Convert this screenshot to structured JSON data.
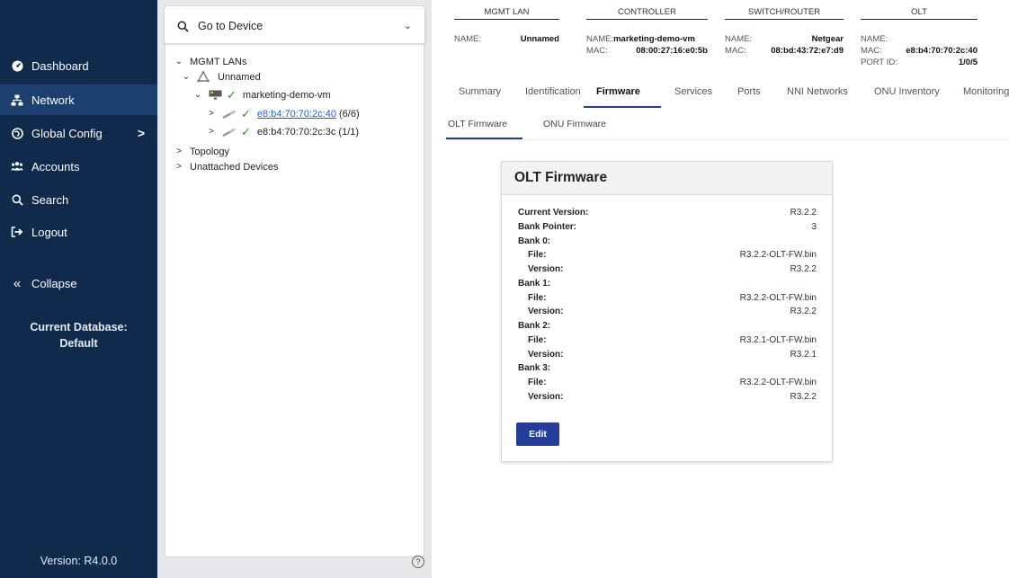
{
  "sidebar": {
    "items": [
      {
        "label": "Dashboard",
        "icon": "dashboard-icon"
      },
      {
        "label": "Network",
        "icon": "network-icon",
        "active": true
      },
      {
        "label": "Global Config",
        "icon": "globe-icon",
        "has_chevron": true
      },
      {
        "label": "Accounts",
        "icon": "accounts-icon"
      },
      {
        "label": "Search",
        "icon": "search-icon"
      },
      {
        "label": "Logout",
        "icon": "logout-icon"
      }
    ],
    "collapse_label": "Collapse",
    "db_line1": "Current Database:",
    "db_line2": "Default",
    "version": "Version: R4.0.0",
    "colors": {
      "bg": "#102a4c",
      "active": "#1b3f6e"
    }
  },
  "tree": {
    "goto_label": "Go to Device",
    "mgmt_lans": "MGMT LANs",
    "unnamed": "Unnamed",
    "controller": "marketing-demo-vm",
    "olt1_link": "e8:b4:70:70:2c:40",
    "olt1_count": "(6/6)",
    "olt2": "e8:b4:70:70:2c:3c (1/1)",
    "topology": "Topology",
    "unattached": "Unattached Devices"
  },
  "header": {
    "mgmt_lan": {
      "title": "MGMT LAN",
      "name_key": "NAME:",
      "name_val": "Unnamed"
    },
    "controller": {
      "title": "CONTROLLER",
      "name_key": "NAME:",
      "name_val": "marketing-demo-vm",
      "mac_key": "MAC:",
      "mac_val": "08:00:27:16:e0:5b"
    },
    "switch": {
      "title": "SWITCH/ROUTER",
      "name_key": "NAME:",
      "name_val": "Netgear",
      "mac_key": "MAC:",
      "mac_val": "08:bd:43:72:e7:d9"
    },
    "olt": {
      "title": "OLT",
      "name_key": "NAME:",
      "mac_key": "MAC:",
      "mac_val": "e8:b4:70:70:2c:40",
      "port_key": "PORT ID:",
      "port_val": "1/0/5"
    }
  },
  "tabs": [
    "Summary",
    "Identification",
    "Firmware",
    "Services",
    "Ports",
    "NNI Networks",
    "ONU Inventory",
    "Monitoring"
  ],
  "active_tab": "Firmware",
  "subtabs": [
    "OLT Firmware",
    "ONU Firmware"
  ],
  "firmware": {
    "title": "OLT Firmware",
    "rows": [
      {
        "label": "Current Version:",
        "value": "R3.2.2",
        "indent": false
      },
      {
        "label": "Bank Pointer:",
        "value": "3",
        "indent": false
      },
      {
        "label": "Bank 0:",
        "value": "",
        "indent": false
      },
      {
        "label": "File:",
        "value": "R3.2.2-OLT-FW.bin",
        "indent": true
      },
      {
        "label": "Version:",
        "value": "R3.2.2",
        "indent": true
      },
      {
        "label": "Bank 1:",
        "value": "",
        "indent": false
      },
      {
        "label": "File:",
        "value": "R3.2.2-OLT-FW.bin",
        "indent": true
      },
      {
        "label": "Version:",
        "value": "R3.2.2",
        "indent": true
      },
      {
        "label": "Bank 2:",
        "value": "",
        "indent": false
      },
      {
        "label": "File:",
        "value": "R3.2.1-OLT-FW.bin",
        "indent": true
      },
      {
        "label": "Version:",
        "value": "R3.2.1",
        "indent": true
      },
      {
        "label": "Bank 3:",
        "value": "",
        "indent": false
      },
      {
        "label": "File:",
        "value": "R3.2.2-OLT-FW.bin",
        "indent": true
      },
      {
        "label": "Version:",
        "value": "R3.2.2",
        "indent": true
      }
    ],
    "edit_label": "Edit"
  },
  "help_symbol": "?"
}
